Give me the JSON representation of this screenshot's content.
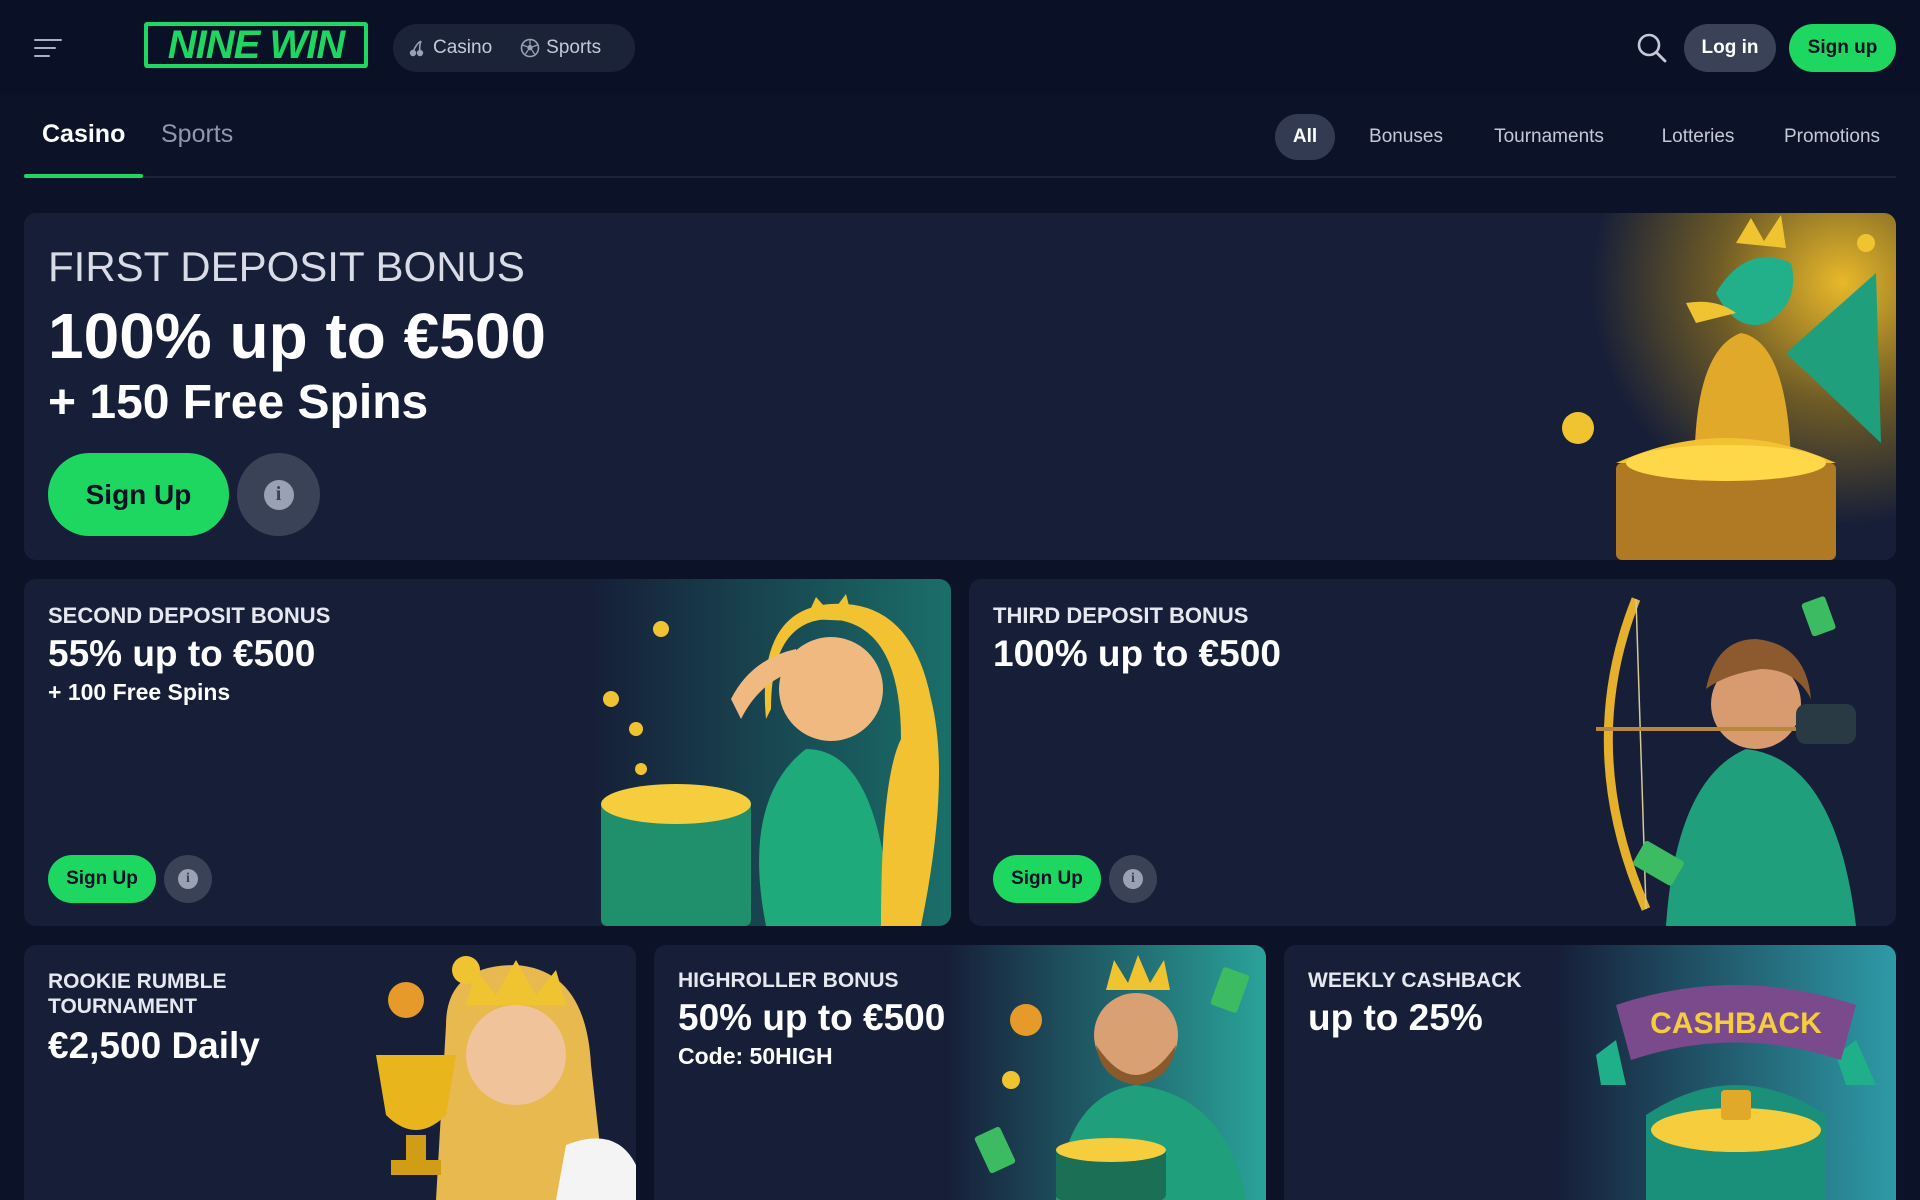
{
  "header": {
    "logo_text": "NINE WIN",
    "modes": [
      {
        "label": "Casino",
        "icon": "cherry-icon"
      },
      {
        "label": "Sports",
        "icon": "soccer-ball-icon"
      }
    ],
    "login_label": "Log in",
    "signup_label": "Sign up"
  },
  "tabs": {
    "main": [
      "Casino",
      "Sports"
    ],
    "filters": [
      "All",
      "Bonuses",
      "Tournaments",
      "Lotteries",
      "Promotions"
    ],
    "active_filter": "All"
  },
  "promos": {
    "first": {
      "kicker": "FIRST DEPOSIT BONUS",
      "headline": "100% up to €500",
      "subline": "+ 150 Free Spins",
      "button": "Sign Up",
      "art": "dragon-treasure-chest"
    },
    "second": {
      "kicker": "SECOND DEPOSIT BONUS",
      "headline": "55% up to €500",
      "subline": "+ 100 Free Spins",
      "button": "Sign Up",
      "art": "princess-treasure-chest"
    },
    "third": {
      "kicker": "THIRD DEPOSIT BONUS",
      "headline": "100% up to €500",
      "button": "Sign Up",
      "art": "archer-elf"
    },
    "rookie": {
      "kicker": "ROOKIE RUMBLE TOURNAMENT",
      "headline": "€2,500 Daily",
      "art": "queen-trophy"
    },
    "highroller": {
      "kicker": "HIGHROLLER BONUS",
      "headline": "50% up to €500",
      "subline": "Code: 50HIGH",
      "art": "king-gold"
    },
    "cashback": {
      "kicker": "WEEKLY CASHBACK",
      "headline": "up to 25%",
      "badge": "CASHBACK",
      "art": "cashback-chest"
    }
  },
  "colors": {
    "background": "#0c1329",
    "card": "#161e38",
    "accent": "#1ed760"
  }
}
